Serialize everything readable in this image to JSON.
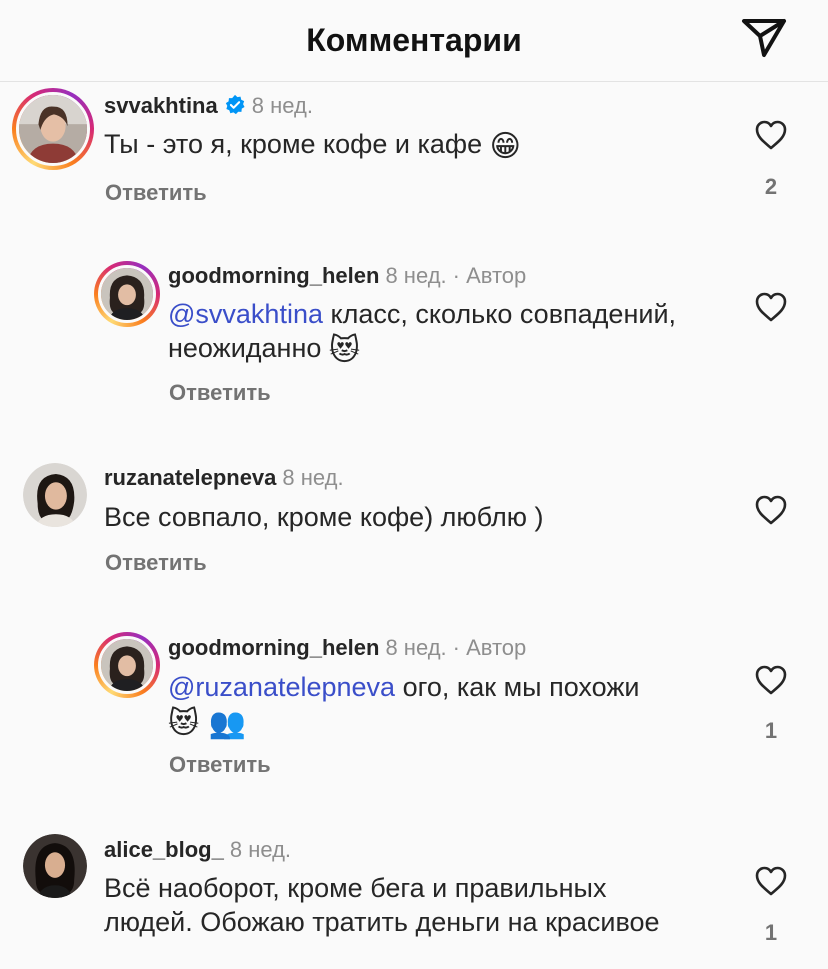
{
  "header": {
    "title": "Комментарии"
  },
  "icons": {
    "send": "paper-plane-icon",
    "like": "heart-icon",
    "verified": "verified-badge-icon"
  },
  "colors": {
    "mention": "#3a4ec9",
    "verified": "#0095f6",
    "muted": "#8e8e8e"
  },
  "comments": [
    {
      "username": "svvakhtina",
      "verified": true,
      "time": "8 нед.",
      "text": "Ты - это я, кроме кофе и кафе",
      "emoji": "😁",
      "reply_label": "Ответить",
      "likes": "2"
    },
    {
      "username": "goodmorning_helen",
      "time": "8 нед.",
      "author_label": "· Автор",
      "mention": "@svvakhtina",
      "text_line1": "класс, сколько совпадений,",
      "text_line2": "неожиданно",
      "emoji": "😻",
      "reply_label": "Ответить"
    },
    {
      "username": "ruzanatelepneva",
      "time": "8 нед.",
      "text": "Все совпало, кроме кофе) люблю )",
      "reply_label": "Ответить"
    },
    {
      "username": "goodmorning_helen",
      "time": "8 нед.",
      "author_label": "· Автор",
      "mention": "@ruzanatelepneva",
      "text_line1": "ого, как мы похожи",
      "emoji": "😻 👥",
      "reply_label": "Ответить",
      "likes": "1"
    },
    {
      "username": "alice_blog_",
      "time": "8 нед.",
      "text_line1": "Всё наоборот, кроме бега и правильных",
      "text_line2": "людей. Обожаю тратить деньги на красивое",
      "likes": "1"
    }
  ]
}
